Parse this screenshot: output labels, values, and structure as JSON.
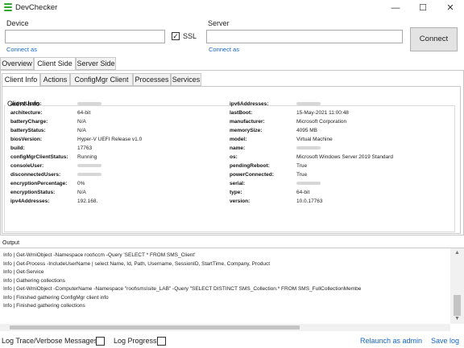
{
  "window": {
    "title": "DevChecker",
    "minimize_glyph": "—",
    "maximize_glyph": "☐",
    "close_glyph": "✕"
  },
  "connection": {
    "device_label": "Device",
    "device_value": "",
    "ssl_label": "SSL",
    "ssl_checked": true,
    "device_connect_as": "Connect as",
    "server_label": "Server",
    "server_value": "",
    "server_connect_as": "Connect as",
    "connect_button": "Connect"
  },
  "main_tabs": [
    "Overview",
    "Client Side",
    "Server Side"
  ],
  "main_tab_active": "Client Side",
  "sub_tabs": [
    "Client Info",
    "Actions",
    "ConfigMgr Client",
    "Processes",
    "Services"
  ],
  "sub_tab_active": "Client Info",
  "client_info": {
    "title": "Client Info",
    "left": [
      {
        "key": "activeUsers:",
        "value": ""
      },
      {
        "key": "architecture:",
        "value": "64-bit"
      },
      {
        "key": "batteryCharge:",
        "value": "N/A"
      },
      {
        "key": "batteryStatus:",
        "value": "N/A"
      },
      {
        "key": "biosVersion:",
        "value": "Hyper-V UEFI Release v1.0"
      },
      {
        "key": "build:",
        "value": "17763"
      },
      {
        "key": "configMgrClientStatus:",
        "value": "Running"
      },
      {
        "key": "consoleUser:",
        "value": ""
      },
      {
        "key": "disconnectedUsers:",
        "value": ""
      },
      {
        "key": "encryptionPercentage:",
        "value": "0%"
      },
      {
        "key": "encryptionStatus:",
        "value": "N/A"
      },
      {
        "key": "ipv4Addresses:",
        "value": "192.168."
      }
    ],
    "right": [
      {
        "key": "ipv6Addresses:",
        "value": ""
      },
      {
        "key": "lastBoot:",
        "value": "15-May-2021 11:00:48"
      },
      {
        "key": "manufacturer:",
        "value": "Microsoft Corporation"
      },
      {
        "key": "memorySize:",
        "value": "4095 MB"
      },
      {
        "key": "model:",
        "value": "Virtual Machine"
      },
      {
        "key": "name:",
        "value": ""
      },
      {
        "key": "os:",
        "value": "Microsoft Windows Server 2019 Standard"
      },
      {
        "key": "pendingReboot:",
        "value": "True"
      },
      {
        "key": "powerConnected:",
        "value": "True"
      },
      {
        "key": "serial:",
        "value": ""
      },
      {
        "key": "type:",
        "value": "64-bit"
      },
      {
        "key": "version:",
        "value": "10.0.17763"
      }
    ]
  },
  "output": {
    "label": "Output",
    "lines": [
      "Info | Get-WmiObject -Namespace root\\ccm -Query 'SELECT * FROM SMS_Client'",
      "Info | Get-Process -IncludeUserName | select Name, Id, Path, Username, SessionID, StartTime, Company, Product",
      "Info | Get-Service",
      "Info | Gathering collections",
      "Info | Get-WmiObject -ComputerName                    -Namespace \"root\\sms\\site_LAB\" -Query \"SELECT DISTINCT SMS_Collection.* FROM SMS_FullCollectionMembe",
      "Info | Finished gathering ConfigMgr client info",
      "Info | Finished gathering collections"
    ]
  },
  "footer": {
    "log_trace_label": "Log Trace/Verbose Messages",
    "log_trace_checked": false,
    "log_progress_label": "Log Progress",
    "log_progress_checked": false,
    "relaunch_link": "Relaunch as admin",
    "save_log_link": "Save log"
  },
  "colors": {
    "link": "#1565c0",
    "app_icon": "#2fa82f"
  }
}
